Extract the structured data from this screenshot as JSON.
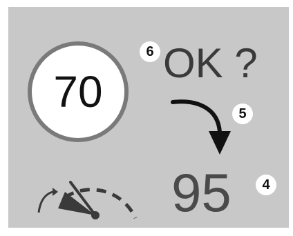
{
  "speed_limit": {
    "value": "70"
  },
  "prompt": {
    "text": "OK ?"
  },
  "current_speed": {
    "value": "95"
  },
  "badges": {
    "speed_sign": "6",
    "arrow": "5",
    "current_speed": "4"
  },
  "icons": {
    "gauge": "speedometer-icon",
    "arrow": "curved-arrow-down-icon"
  },
  "colors": {
    "panel": "#c8c8c8",
    "sign_border": "#7a7a7a",
    "text_dark": "#3a3a3a",
    "icon": "#3a3a3a"
  }
}
